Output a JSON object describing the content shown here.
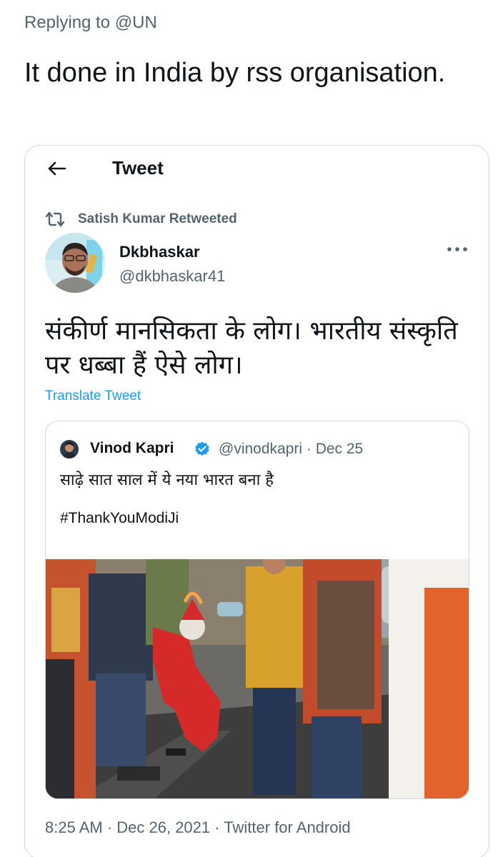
{
  "reply": {
    "prefix": "Replying to ",
    "handle": "@UN",
    "text": "It done in India by rss organisation."
  },
  "card": {
    "topbar_title": "Tweet",
    "retweet_label": "Satish Kumar Retweeted",
    "author": {
      "name": "Dkbhaskar",
      "handle": "@dkbhaskar41"
    },
    "text": "संकीर्ण मानसिकता के लोग। भारतीय संस्कृति पर धब्बा हैं ऐसे लोग।",
    "translate_label": "Translate Tweet",
    "quote": {
      "name": "Vinod Kapri",
      "meta": "@vinodkapri · Dec 25",
      "text": "साढ़े सात साल में ये नया भारत बना है",
      "hashtag": "#ThankYouModiJi"
    },
    "footer": "8:25 AM · Dec 26, 2021 · Twitter for Android"
  },
  "icons": {
    "back": "back-arrow-icon",
    "retweet": "retweet-icon",
    "more": "more-options-icon",
    "verified": "verified-badge-icon"
  },
  "colors": {
    "link": "#1d9bf0",
    "muted": "#536471",
    "border": "#cfd9de"
  }
}
